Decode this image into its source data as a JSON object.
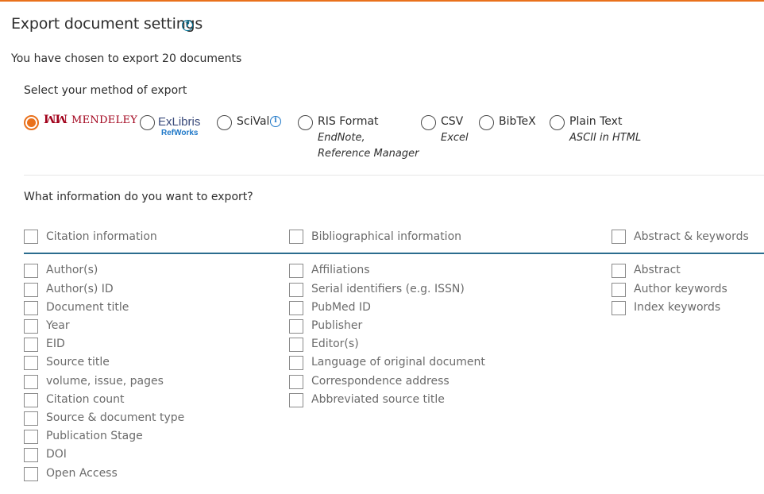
{
  "colors": {
    "accent": "#e9711c",
    "link": "#007398",
    "rule": "#2b6c8e",
    "mendeley": "#a1001a",
    "refworks": "#1f78c8"
  },
  "header": {
    "title": "Export document settings",
    "help_icon": "question-circle-icon"
  },
  "summary": "You have chosen to export 20 documents",
  "export_method": {
    "label": "Select your method of export",
    "selected": "mendeley",
    "options": [
      {
        "id": "mendeley",
        "logo_text": "MENDELEY",
        "logo_mark": "ꟽꟽ"
      },
      {
        "id": "refworks",
        "logo_text": "ExLibris",
        "logo_sub": "RefWorks"
      },
      {
        "id": "scival",
        "label": "SciVal",
        "icon": "info-circle-icon"
      },
      {
        "id": "ris",
        "label": "RIS Format",
        "sub1": "EndNote,",
        "sub2": "Reference Manager"
      },
      {
        "id": "csv",
        "label": "CSV",
        "sub1": "Excel"
      },
      {
        "id": "bibtex",
        "label": "BibTeX"
      },
      {
        "id": "plaintext",
        "label": "Plain Text",
        "sub1": "ASCII in HTML"
      }
    ]
  },
  "information": {
    "label": "What information do you want to export?",
    "groups": [
      {
        "title": "Citation information",
        "items": [
          "Author(s)",
          "Author(s) ID",
          "Document title",
          "Year",
          "EID",
          "Source title",
          "volume, issue, pages",
          "Citation count",
          "Source & document type",
          "Publication Stage",
          "DOI",
          "Open Access"
        ]
      },
      {
        "title": "Bibliographical information",
        "items": [
          "Affiliations",
          "Serial identifiers (e.g. ISSN)",
          "PubMed ID",
          "Publisher",
          "Editor(s)",
          "Language of original document",
          "Correspondence address",
          "Abbreviated source title"
        ]
      },
      {
        "title": "Abstract & keywords",
        "items": [
          "Abstract",
          "Author keywords",
          "Index keywords"
        ]
      }
    ]
  }
}
